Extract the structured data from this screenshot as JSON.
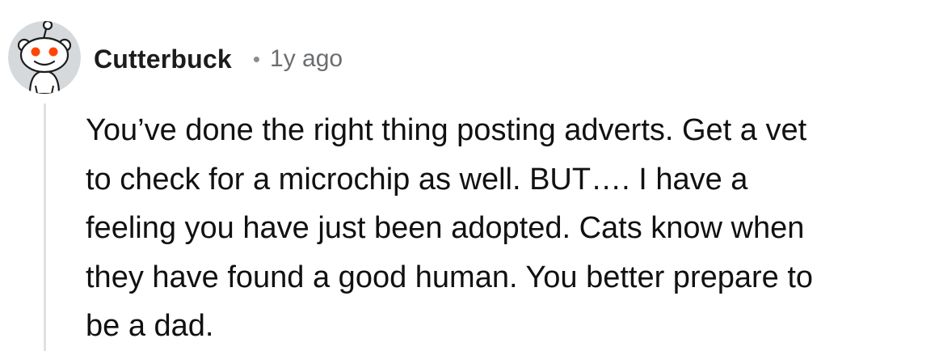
{
  "comment": {
    "author": "Cutterbuck",
    "separator": "•",
    "timestamp": "1y ago",
    "avatar_icon": "reddit-snoo-avatar-icon",
    "body_lines": [
      "You’ve done the right thing posting adverts. Get a vet",
      "to check for a microchip as well. BUT…. I have a",
      "feeling you have just been adopted. Cats know when",
      "they have found a good human. You better prepare to",
      "be a dad."
    ]
  },
  "colors": {
    "avatar_background": "#d5d9dc",
    "avatar_eye": "#ff4500",
    "thread_line": "#dfe1e3",
    "meta_text": "#6b6e70"
  }
}
